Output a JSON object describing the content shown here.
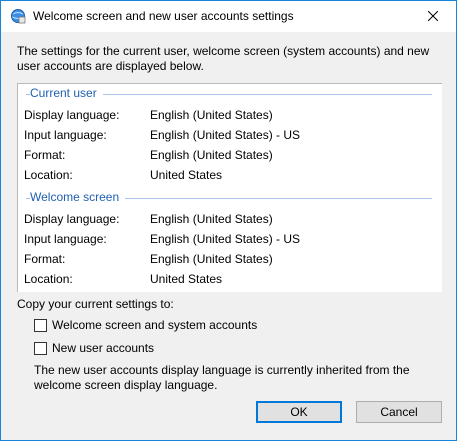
{
  "window": {
    "title": "Welcome screen and new user accounts settings"
  },
  "intro": "The settings for the current user, welcome screen (system accounts) and new user accounts are displayed below.",
  "current_user": {
    "heading": "Current user",
    "rows": [
      {
        "label": "Display language:",
        "value": "English (United States)"
      },
      {
        "label": "Input language:",
        "value": "English (United States) - US"
      },
      {
        "label": "Format:",
        "value": "English (United States)"
      },
      {
        "label": "Location:",
        "value": "United States"
      }
    ]
  },
  "welcome_screen": {
    "heading": "Welcome screen",
    "rows": [
      {
        "label": "Display language:",
        "value": "English (United States)"
      },
      {
        "label": "Input language:",
        "value": "English (United States) - US"
      },
      {
        "label": "Format:",
        "value": "English (United States)"
      },
      {
        "label": "Location:",
        "value": "United States"
      }
    ]
  },
  "copy": {
    "label": "Copy your current settings to:",
    "options": [
      {
        "label": "Welcome screen and system accounts",
        "checked": false
      },
      {
        "label": "New user accounts",
        "checked": false
      }
    ]
  },
  "note": "The new user accounts display language is currently inherited from the welcome screen display language.",
  "buttons": {
    "ok": "OK",
    "cancel": "Cancel"
  },
  "colors": {
    "accent": "#0078d7",
    "section_heading": "#1f5fb3"
  }
}
